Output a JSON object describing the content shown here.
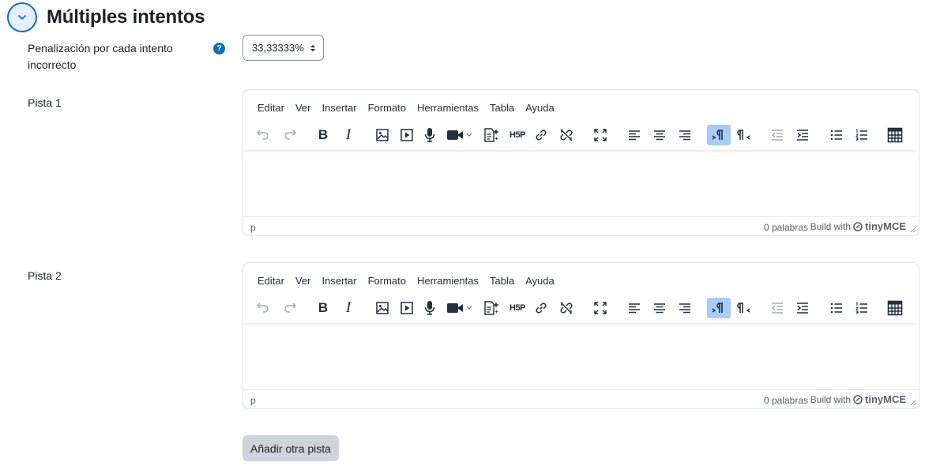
{
  "section": {
    "title": "Múltiples intentos"
  },
  "penalty": {
    "label": "Penalización por cada intento incorrecto",
    "value": "33,33333%",
    "help": "?"
  },
  "hints": [
    {
      "label": "Pista 1",
      "path": "p",
      "words": "0 palabras",
      "build": "Build with",
      "brand": "tinyMCE"
    },
    {
      "label": "Pista 2",
      "path": "p",
      "words": "0 palabras",
      "build": "Build with",
      "brand": "tinyMCE"
    }
  ],
  "menubar": [
    "Editar",
    "Ver",
    "Insertar",
    "Formato",
    "Herramientas",
    "Tabla",
    "Ayuda"
  ],
  "add_button": "Añadir otra pista",
  "colors": {
    "accent": "#0f6cbf",
    "active_tool": "#a6ccf7",
    "button_disabled": "#ced4da"
  }
}
